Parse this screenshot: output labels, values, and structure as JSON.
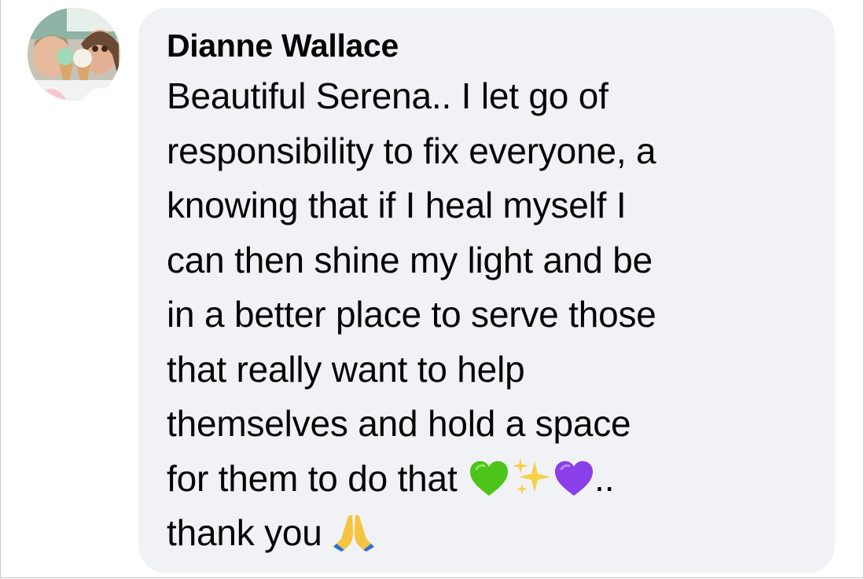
{
  "comment": {
    "author": "Dianne Wallace",
    "lines": [
      "Beautiful Serena.. I let go of",
      "responsibility to fix everyone, a",
      "knowing that if I heal myself I",
      "can then shine my light and be",
      "in a better place to serve those",
      "that really want to help",
      "themselves and hold a space",
      "for them to do that",
      "thank you"
    ],
    "line8_trailing": "..",
    "emojis": [
      "green-heart",
      "sparkles",
      "purple-heart",
      "folded-hands"
    ]
  },
  "colors": {
    "bubble_background": "#f0f2f5",
    "text": "#050505",
    "green_heart": "#4cc419",
    "purple_heart": "#8a3fe8",
    "sparkles": "#f7d14a"
  }
}
